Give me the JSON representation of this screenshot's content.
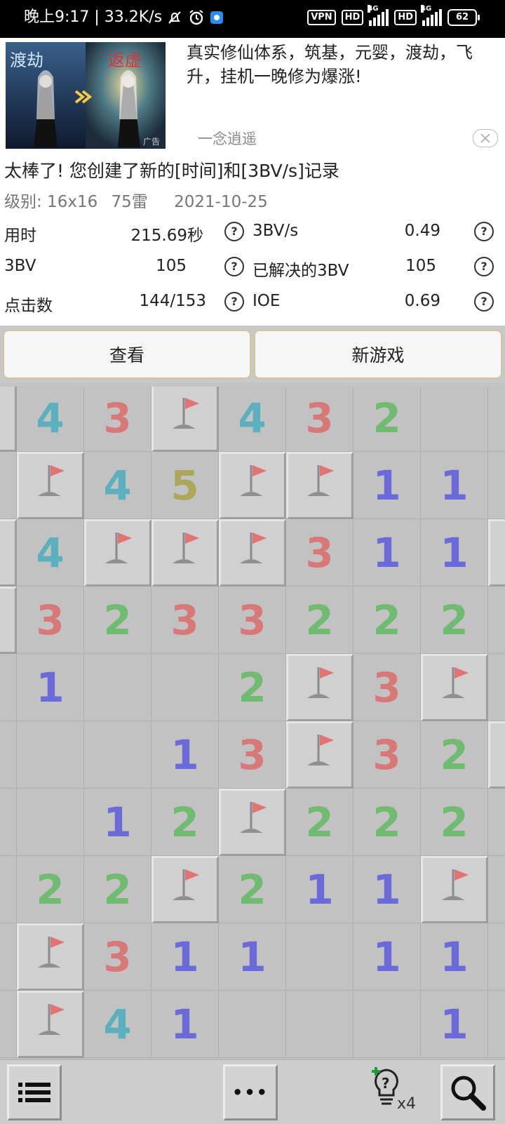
{
  "status_bar": {
    "left_text": "晚上9:17 | 33.2K/s",
    "vpn": "VPN",
    "hd1": "HD",
    "net1": "4G",
    "hd2": "HD",
    "net2": "4G",
    "battery": "62"
  },
  "ad": {
    "image_caption_1": "渡劫",
    "image_caption_2": "返虚",
    "image_tag": "广告",
    "text": "真实修仙体系，筑基，元婴，渡劫，飞升，挂机一晚修为爆涨!",
    "brand": "一念逍遥"
  },
  "result": {
    "headline": "太棒了! 您创建了新的[时间]和[3BV/s]记录",
    "level": "级别: 16x16",
    "mines": "75雷",
    "date": "2021-10-25",
    "stats": [
      {
        "label": "用时",
        "value": "215.69秒",
        "label2": "3BV/s",
        "value2": "0.49"
      },
      {
        "label": "3BV",
        "value": "105",
        "label2": "已解决的3BV",
        "value2": "105"
      },
      {
        "label": "点击数",
        "value": "144/153",
        "label2": "IOE",
        "value2": "0.69"
      }
    ],
    "help_glyph": "?"
  },
  "buttons": {
    "view": "查看",
    "new_game": "新游戏"
  },
  "board": {
    "rows": [
      [
        "R",
        "4",
        "3",
        "F",
        "4",
        "3",
        "2",
        "",
        ""
      ],
      [
        "",
        "F",
        "4",
        "5",
        "F",
        "F",
        "1",
        "1",
        ""
      ],
      [
        "R",
        "4",
        "F",
        "F",
        "F",
        "3",
        "1",
        "1",
        "R"
      ],
      [
        "R",
        "3",
        "2",
        "3",
        "3",
        "2",
        "2",
        "2",
        ""
      ],
      [
        "",
        "1",
        "",
        "",
        "2",
        "F",
        "3",
        "F",
        ""
      ],
      [
        "",
        "",
        "",
        "1",
        "3",
        "F",
        "3",
        "2",
        "R"
      ],
      [
        "",
        "",
        "1",
        "2",
        "F",
        "2",
        "2",
        "2",
        ""
      ],
      [
        "",
        "2",
        "2",
        "F",
        "2",
        "1",
        "1",
        "F",
        ""
      ],
      [
        "",
        "F",
        "3",
        "1",
        "1",
        "",
        "1",
        "1",
        ""
      ],
      [
        "",
        "F",
        "4",
        "1",
        "",
        "",
        "",
        "1",
        ""
      ]
    ]
  },
  "bottom": {
    "hint_count": "x4",
    "more": "•••"
  }
}
